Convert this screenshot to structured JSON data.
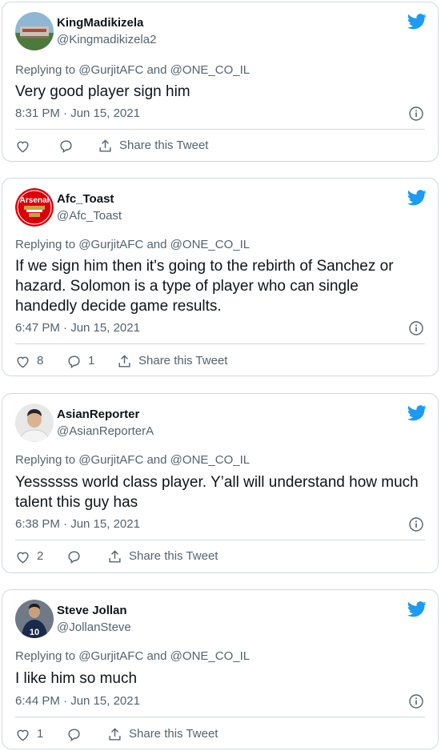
{
  "tweets": [
    {
      "name": "KingMadikizela",
      "handle": "@Kingmadikizela2",
      "replying_prefix": "Replying to",
      "reply_to_1": "@GurjitAFC",
      "and": "and",
      "reply_to_2": "@ONE_CO_IL",
      "text": "Very good player sign him",
      "time": "8:31 PM · Jun 15, 2021",
      "likes": "",
      "replies": "",
      "share": "Share this Tweet",
      "avatar": "stadium-avatar"
    },
    {
      "name": "Afc_Toast",
      "handle": "@Afc_Toast",
      "replying_prefix": "Replying to",
      "reply_to_1": "@GurjitAFC",
      "and": "and",
      "reply_to_2": "@ONE_CO_IL",
      "text": "If we sign him then it's going to the rebirth of Sanchez or hazard. Solomon is a type of player who can single handedly decide game results.",
      "time": "6:47 PM · Jun 15, 2021",
      "likes": "8",
      "replies": "1",
      "share": "Share this Tweet",
      "avatar": "arsenal-crest-avatar",
      "avatar_text": "Arsenal"
    },
    {
      "name": "AsianReporter",
      "handle": "@AsianReporterA",
      "replying_prefix": "Replying to",
      "reply_to_1": "@GurjitAFC",
      "and": "and",
      "reply_to_2": "@ONE_CO_IL",
      "text": "Yessssss world class player. Y’all will understand how much talent this guy has",
      "time": "6:38 PM · Jun 15, 2021",
      "likes": "2",
      "replies": "",
      "share": "Share this Tweet",
      "avatar": "person-avatar"
    },
    {
      "name": "Steve Jollan",
      "handle": "@JollanSteve",
      "replying_prefix": "Replying to",
      "reply_to_1": "@GurjitAFC",
      "and": "and",
      "reply_to_2": "@ONE_CO_IL",
      "text": "I like him so much",
      "time": "6:44 PM · Jun 15, 2021",
      "likes": "1",
      "replies": "",
      "share": "Share this Tweet",
      "avatar": "player-avatar",
      "avatar_text": "10"
    }
  ],
  "colors": {
    "twitter_blue": "#1d9bf0",
    "secondary_text": "#536471",
    "border": "#cfd9de",
    "arsenal_red": "#db0007"
  }
}
